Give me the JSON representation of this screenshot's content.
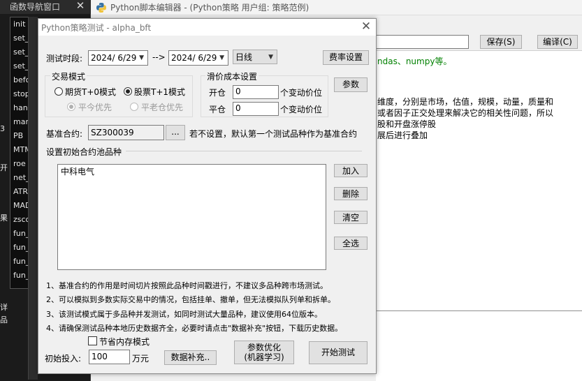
{
  "nav": {
    "title": "函数导航窗口",
    "items": [
      "init",
      "set_par",
      "set_var",
      "set_bar",
      "before_",
      "stop_lo",
      "handle_",
      "market",
      "PB",
      "MTM20",
      "roe",
      "net_pro",
      "ATR20",
      "MAD",
      "zscore",
      "fun_hig",
      "fun_st",
      "fun_un",
      "fun_rel"
    ],
    "side_fragments": [
      "3",
      "开",
      "果",
      "详",
      "品"
    ]
  },
  "editor": {
    "title": "Python脚本编辑器 - (Python策略 用户组: 策略范例)",
    "save_button": "保存(S)",
    "compile_button": "编译(C)",
    "code_lines": [
      "ndas、numpy等。",
      "维度，分别是市场，估值，规模，动量，质量和",
      "或者因子正交处理来解决它的相关性问题，所以",
      "股和开盘涨停股",
      "展后进行叠加"
    ]
  },
  "dialog": {
    "title": "Python策略测试 - alpha_bft",
    "test_period_label": "测试时段:",
    "start_date": "2024/ 6/29",
    "arrow": "-->",
    "end_date": "2024/ 6/29",
    "period": "日线",
    "fee_button": "费率设置",
    "trade_mode": {
      "legend": "交易模式",
      "futures": "期货T+0模式",
      "stock": "股票T+1模式",
      "close_today": "平今优先",
      "close_old": "平老仓优先"
    },
    "slippage": {
      "legend": "滑价成本设置",
      "open_label": "开仓",
      "open_value": "0",
      "close_label": "平仓",
      "close_value": "0",
      "unit": "个变动价位"
    },
    "params_button": "参数",
    "benchmark_label": "基准合约:",
    "benchmark_value": "SZ300039",
    "browse_button": "...",
    "benchmark_hint": "若不设置，默认第一个测试品种作为基准合约",
    "pool_label": "设置初始合约池品种",
    "pool_items": [
      "中科电气"
    ],
    "add_button": "加入",
    "delete_button": "删除",
    "clear_button": "清空",
    "select_all_button": "全选",
    "notes": [
      "1、基准合约的作用是时间切片按照此品种时间戳进行，不建议多品种跨市场测试。",
      "2、可以模拟到多数实际交易中的情况，包括挂单、撤单，但无法模拟队列单和拆单。",
      "3、该测试模式属于多品种并发测试，如同时测试大量品种，建议使用64位版本。",
      "4、请确保测试品种本地历史数据齐全，必要时请点击\"数据补充\"按钮，下载历史数据。"
    ],
    "save_memory": "节省内存模式",
    "initial_investment_label": "初始投入:",
    "initial_investment_value": "100",
    "unit_wan": "万元",
    "data_supplement_button": "数据补充..",
    "optimize_button_line1": "参数优化",
    "optimize_button_line2": "(机器学习)",
    "start_button": "开始测试"
  },
  "colors": {
    "dark_bg": "#1b1b1b",
    "dialog_bg": "#f0f0f0",
    "code_green": "#008000"
  }
}
